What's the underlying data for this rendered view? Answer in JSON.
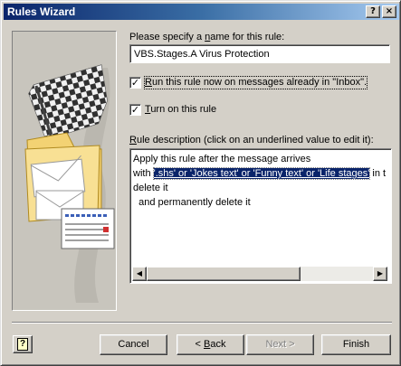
{
  "window": {
    "title": "Rules Wizard",
    "help_glyph": "?",
    "close_glyph": "×"
  },
  "name_section": {
    "label_pre": "Please specify a ",
    "label_accel": "n",
    "label_post": "ame for this rule:",
    "value": "VBS.Stages.A Virus Protection"
  },
  "options": {
    "run_now": {
      "accel": "R",
      "label_post": "un this rule now on messages already in \"Inbox\".",
      "checked": true
    },
    "turn_on": {
      "accel": "T",
      "label_post": "urn on this rule",
      "checked": true
    }
  },
  "description": {
    "label_accel": "R",
    "label_post": "ule description (click on an underlined value to edit it):",
    "line1": "Apply this rule after the message arrives",
    "line2_pre": "with ",
    "line2_link": "'.shs' or 'Jokes text' or 'Funny text' or 'Life stages'",
    "line2_post": " in t",
    "line3": "delete it",
    "line4": "  and permanently delete it",
    "scroll_left_glyph": "◀",
    "scroll_right_glyph": "▶"
  },
  "buttons": {
    "help_glyph": "?",
    "cancel": "Cancel",
    "back_pre": "< ",
    "back_accel": "B",
    "back_post": "ack",
    "next": "Next >",
    "finish": "Finish"
  },
  "colors": {
    "dialog_face": "#d4d0c8",
    "titlebar_start": "#0a246a",
    "titlebar_end": "#a6caf0",
    "selection": "#0a246a"
  },
  "icons": {
    "wizard_illustration": "checkered-flag-with-folders-and-envelopes"
  }
}
